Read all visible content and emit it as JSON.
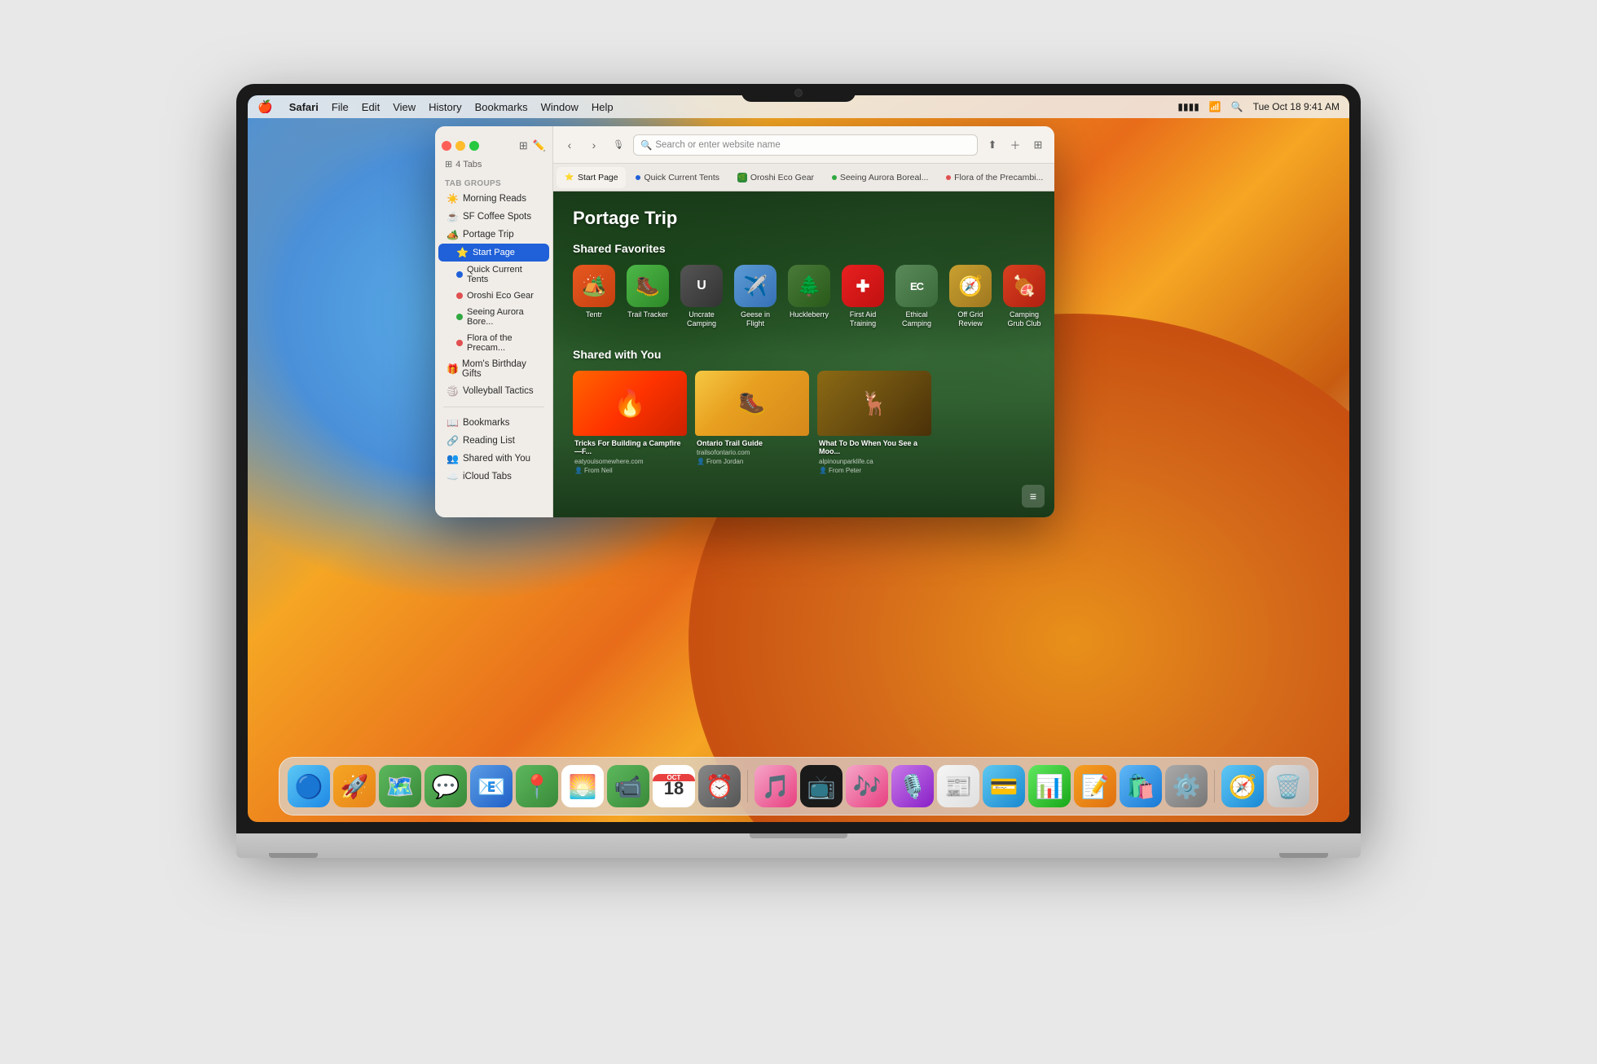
{
  "menubar": {
    "apple": "🍎",
    "app_name": "Safari",
    "menus": [
      "File",
      "Edit",
      "View",
      "History",
      "Bookmarks",
      "Window",
      "Help"
    ],
    "right_items": [
      "battery",
      "wifi",
      "search",
      "datetime"
    ],
    "datetime": "Tue Oct 18  9:41 AM"
  },
  "safari": {
    "window_title": "Portage Trip",
    "tab_count": "4 Tabs",
    "tab_groups_label": "Tab Groups",
    "sidebar_items": [
      {
        "id": "morning-reads",
        "label": "Morning Reads",
        "icon": "☀️",
        "type": "group"
      },
      {
        "id": "coffee-spots",
        "label": "SF Coffee Spots",
        "icon": "☕",
        "type": "group"
      },
      {
        "id": "portage-trip",
        "label": "Portage Trip",
        "icon": "🏕️",
        "type": "group",
        "active": true
      }
    ],
    "portage_tabs": [
      {
        "id": "start-page",
        "label": "Start Page",
        "icon": "⭐",
        "active": true
      },
      {
        "id": "quick-current-tents",
        "label": "Quick Current Tents",
        "color": "#1a6de8"
      },
      {
        "id": "oroshi-eco-gear",
        "label": "Oroshi Eco Gear",
        "color": "#e84040"
      },
      {
        "id": "seeing-aurora",
        "label": "Seeing Aurora Bore...",
        "color": "#2db848"
      },
      {
        "id": "flora-precam",
        "label": "Flora of the Precam...",
        "color": "#e84040"
      }
    ],
    "other_groups": [
      {
        "id": "moms-birthday",
        "label": "Mom's Birthday Gifts",
        "icon": "🎁"
      },
      {
        "id": "volleyball",
        "label": "Volleyball Tactics",
        "icon": "🏐"
      }
    ],
    "sidebar_bottom": [
      {
        "id": "bookmarks",
        "label": "Bookmarks",
        "icon": "📖"
      },
      {
        "id": "reading-list",
        "label": "Reading List",
        "icon": "🔗"
      },
      {
        "id": "shared-with-you",
        "label": "Shared with You",
        "icon": "👥"
      },
      {
        "id": "icloud-tabs",
        "label": "iCloud Tabs",
        "icon": "☁️"
      }
    ],
    "tabs": [
      {
        "id": "start-page-tab",
        "label": "Start Page",
        "active": true
      },
      {
        "id": "quick-tents-tab",
        "label": "Quick Current Tents",
        "dot_color": "#2060d8"
      },
      {
        "id": "oroshi-tab",
        "label": "Oroshi Eco Gear",
        "dot_color": "#e05050",
        "emoji": "🌿"
      },
      {
        "id": "aurora-tab",
        "label": "Seeing Aurora Boreal...",
        "dot_color": "#30a840"
      },
      {
        "id": "flora-tab",
        "label": "Flora of the Precambi...",
        "dot_color": "#e05050"
      }
    ],
    "address_bar": {
      "placeholder": "Search or enter website name"
    }
  },
  "start_page": {
    "title": "Portage Trip",
    "shared_favorites_label": "Shared Favorites",
    "favorites": [
      {
        "id": "tentr",
        "label": "Tentr",
        "emoji": "🏕️",
        "color_class": "fav-tentr"
      },
      {
        "id": "trail-tracker",
        "label": "Trail Tracker",
        "emoji": "🥾",
        "color_class": "fav-trail"
      },
      {
        "id": "uncrate-camping",
        "label": "Uncrate Camping",
        "emoji": "U",
        "color_class": "fav-uncrate"
      },
      {
        "id": "geese-in-flight",
        "label": "Geese in Flight",
        "emoji": "✈️",
        "color_class": "fav-geese"
      },
      {
        "id": "huckleberry",
        "label": "Huckleberry",
        "emoji": "🌲",
        "color_class": "fav-huckleberry"
      },
      {
        "id": "first-aid",
        "label": "First Aid Training",
        "emoji": "➕",
        "color_class": "fav-firstaid"
      },
      {
        "id": "ethical-camping",
        "label": "Ethical Camping",
        "emoji": "EC",
        "color_class": "fav-ethical"
      },
      {
        "id": "off-grid-review",
        "label": "Off Grid Review",
        "emoji": "🧭",
        "color_class": "fav-offgrid"
      },
      {
        "id": "camping-grub",
        "label": "Camping Grub Club",
        "emoji": "🍖",
        "color_class": "fav-camping"
      }
    ],
    "shared_with_you_label": "Shared with You",
    "swu_cards": [
      {
        "id": "campfire",
        "title": "Tricks For Building a Campfire—F...",
        "url": "eatyouisomewhere.com",
        "from": "From Neil",
        "img_class": "campfire-img"
      },
      {
        "id": "ontario",
        "title": "Ontario Trail Guide",
        "url": "trailsofontario.com",
        "from": "From Jordan",
        "img_class": "trail-img"
      },
      {
        "id": "moose",
        "title": "What To Do When You See a Moo...",
        "url": "alpinounparklife.ca",
        "from": "From Peter",
        "img_class": "moose-img"
      }
    ]
  },
  "dock": {
    "icons": [
      {
        "id": "finder",
        "emoji": "🔵",
        "label": "Finder"
      },
      {
        "id": "launchpad",
        "emoji": "🚀",
        "label": "Launchpad"
      },
      {
        "id": "maps",
        "emoji": "🗺️",
        "label": "Maps"
      },
      {
        "id": "messages",
        "emoji": "💬",
        "label": "Messages"
      },
      {
        "id": "mail",
        "emoji": "📧",
        "label": "Mail"
      },
      {
        "id": "maps2",
        "emoji": "📍",
        "label": "Maps"
      },
      {
        "id": "photos",
        "emoji": "🌅",
        "label": "Photos"
      },
      {
        "id": "facetime",
        "emoji": "📹",
        "label": "FaceTime"
      },
      {
        "id": "calendar",
        "emoji": "📅",
        "label": "Calendar"
      },
      {
        "id": "time-machine",
        "emoji": "🟤",
        "label": "Time Machine"
      },
      {
        "id": "music",
        "emoji": "🎵",
        "label": "Music"
      },
      {
        "id": "apple-tv",
        "emoji": "📺",
        "label": "Apple TV"
      },
      {
        "id": "itunes",
        "emoji": "🎶",
        "label": "Music"
      },
      {
        "id": "podcasts",
        "emoji": "🎙️",
        "label": "Podcasts"
      },
      {
        "id": "news",
        "emoji": "📰",
        "label": "News"
      },
      {
        "id": "wallet",
        "emoji": "💳",
        "label": "Wallet"
      },
      {
        "id": "numbers",
        "emoji": "📊",
        "label": "Numbers"
      },
      {
        "id": "pages",
        "emoji": "📝",
        "label": "Pages"
      },
      {
        "id": "app-store",
        "emoji": "🛍️",
        "label": "App Store"
      },
      {
        "id": "system-prefs",
        "emoji": "⚙️",
        "label": "System Preferences"
      },
      {
        "id": "safari",
        "emoji": "🧭",
        "label": "Safari"
      },
      {
        "id": "trash",
        "emoji": "🗑️",
        "label": "Trash"
      }
    ]
  }
}
